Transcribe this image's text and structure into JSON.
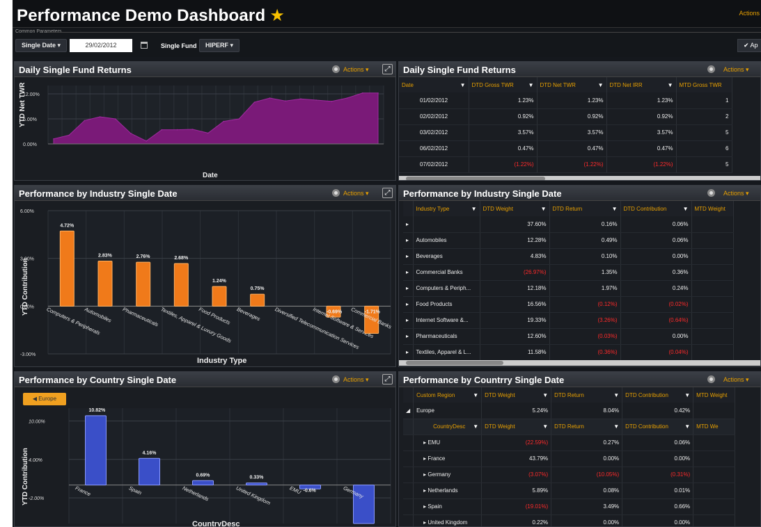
{
  "header": {
    "title": "Performance Demo Dashboard",
    "actions_label": "Actions"
  },
  "params": {
    "legend": "Common Parameters",
    "single_date_label": "Single Date",
    "single_date_value": "29/02/2012",
    "single_fund_label": "Single Fund",
    "single_fund_value": "HIPERF",
    "apply_label": "✔ Ap"
  },
  "panels": {
    "fund_chart": {
      "title": "Daily Single Fund Returns",
      "actions": "Actions"
    },
    "fund_table": {
      "title": "Daily Single Fund Returns",
      "actions": "Actions"
    },
    "industry_chart": {
      "title": "Performance by Industry Single Date",
      "actions": "Actions"
    },
    "industry_table": {
      "title": "Performance by Industry Single Date",
      "actions": "Actions"
    },
    "country_chart": {
      "title": "Performance by Country Single Date",
      "actions": "Actions",
      "breadcrumb": "◀ Europe"
    },
    "country_table": {
      "title": "Performance by Countrry Single Date",
      "actions": "Actions"
    }
  },
  "fund_table": {
    "columns": [
      "Date",
      "DTD Gross TWR",
      "DTD Net TWR",
      "DTD Net IRR",
      "MTD Gross TWR"
    ],
    "rows": [
      [
        "01/02/2012",
        "1.23%",
        "1.23%",
        "1.23%",
        "1"
      ],
      [
        "02/02/2012",
        "0.92%",
        "0.92%",
        "0.92%",
        "2"
      ],
      [
        "03/02/2012",
        "3.57%",
        "3.57%",
        "3.57%",
        "5"
      ],
      [
        "06/02/2012",
        "0.47%",
        "0.47%",
        "0.47%",
        "6"
      ],
      [
        "07/02/2012",
        "(1.22%)",
        "(1.22%)",
        "(1.22%)",
        "5"
      ]
    ]
  },
  "industry_table": {
    "columns": [
      "Industry Type",
      "DTD Weight",
      "DTD Return",
      "DTD Contribution",
      "MTD Weight"
    ],
    "rows": [
      [
        "",
        "37.60%",
        "0.16%",
        "0.06%"
      ],
      [
        "Automobiles",
        "12.28%",
        "0.49%",
        "0.06%"
      ],
      [
        "Beverages",
        "4.83%",
        "0.10%",
        "0.00%"
      ],
      [
        "Commercial Banks",
        "(26.97%)",
        "1.35%",
        "0.36%"
      ],
      [
        "Computers & Periph...",
        "12.18%",
        "1.97%",
        "0.24%"
      ],
      [
        "Food Products",
        "16.56%",
        "(0.12%)",
        "(0.02%)"
      ],
      [
        "Internet Software &...",
        "19.33%",
        "(3.26%)",
        "(0.64%)"
      ],
      [
        "Pharmaceuticals",
        "12.60%",
        "(0.03%)",
        "0.00%"
      ],
      [
        "Textiles, Apparel & L...",
        "11.58%",
        "(0.36%)",
        "(0.04%)"
      ]
    ]
  },
  "country_table": {
    "columns": [
      "Custom Region",
      "DTD Weight",
      "DTD Return",
      "DTD Contribution",
      "MTD Weight"
    ],
    "region_row": [
      "Europe",
      "5.24%",
      "8.04%",
      "0.42%"
    ],
    "sub_columns": [
      "CountryDesc",
      "DTD Weight",
      "DTD Return",
      "DTD Contribution",
      "MTD We"
    ],
    "rows": [
      [
        "EMU",
        "(22.59%)",
        "0.27%",
        "0.06%"
      ],
      [
        "France",
        "43.79%",
        "0.00%",
        "0.00%"
      ],
      [
        "Germany",
        "(3.07%)",
        "(10.05%)",
        "(0.31%)"
      ],
      [
        "Netherlands",
        "5.89%",
        "0.08%",
        "0.01%"
      ],
      [
        "Spain",
        "(19.01%)",
        "3.49%",
        "0.66%"
      ],
      [
        "United Kingdom",
        "0.22%",
        "0.00%",
        "0.00%"
      ]
    ]
  },
  "colors": {
    "accent": "#e8a000",
    "area": "#7a1a78",
    "bar_orange": "#f07a1a",
    "bar_blue": "#3a4fc8",
    "negative": "#ff2a2a"
  },
  "chart_data": [
    {
      "type": "area",
      "ylabel": "YTD Net TWR",
      "xlabel": "Date",
      "y_ticks": [
        "12.00%",
        "6.00%",
        "0.00%"
      ],
      "ylim": [
        0,
        14
      ],
      "values": [
        1.2,
        2.1,
        5.6,
        6.5,
        6.0,
        2.5,
        0.7,
        3.4,
        3.4,
        3.5,
        2.6,
        5.4,
        6.0,
        10.0,
        11.0,
        10.3,
        10.8,
        10.5,
        10.2,
        11.0,
        12.2,
        12.2
      ]
    },
    {
      "type": "bar",
      "ylabel": "YTD Contribution",
      "xlabel": "Industry Type",
      "y_ticks": [
        "6.00%",
        "3.00%",
        "0.00%",
        "-3.00%"
      ],
      "ylim": [
        -3,
        6
      ],
      "categories": [
        "Computers & Peripherals",
        "Automobiles",
        "Pharmaceuticals",
        "Textiles, Apparel & Luxury Goods",
        "Food Products",
        "Beverages",
        "Diversified Telecommunication Services",
        "Internet Software & Services",
        "Commercial Banks"
      ],
      "values": [
        4.72,
        2.83,
        2.76,
        2.68,
        1.24,
        0.75,
        0.0,
        -0.69,
        -1.71
      ],
      "labels": [
        "4.72%",
        "2.83%",
        "2.76%",
        "2.68%",
        "1.24%",
        "0.75%",
        "",
        "-0.69%",
        "-1.71%"
      ]
    },
    {
      "type": "bar",
      "ylabel": "YTD Contribution",
      "xlabel": "CountryDesc",
      "y_ticks": [
        "10.00%",
        "4.00%",
        "-2.00%"
      ],
      "ylim": [
        -6,
        12
      ],
      "categories": [
        "France",
        "Spain",
        "Netherlands",
        "United Kingdom",
        "EMU",
        "Germany"
      ],
      "values": [
        10.82,
        4.16,
        0.69,
        0.33,
        -0.6,
        -6.0
      ],
      "labels": [
        "10.82%",
        "4.16%",
        "0.69%",
        "0.33%",
        "-0.6%",
        ""
      ]
    }
  ]
}
